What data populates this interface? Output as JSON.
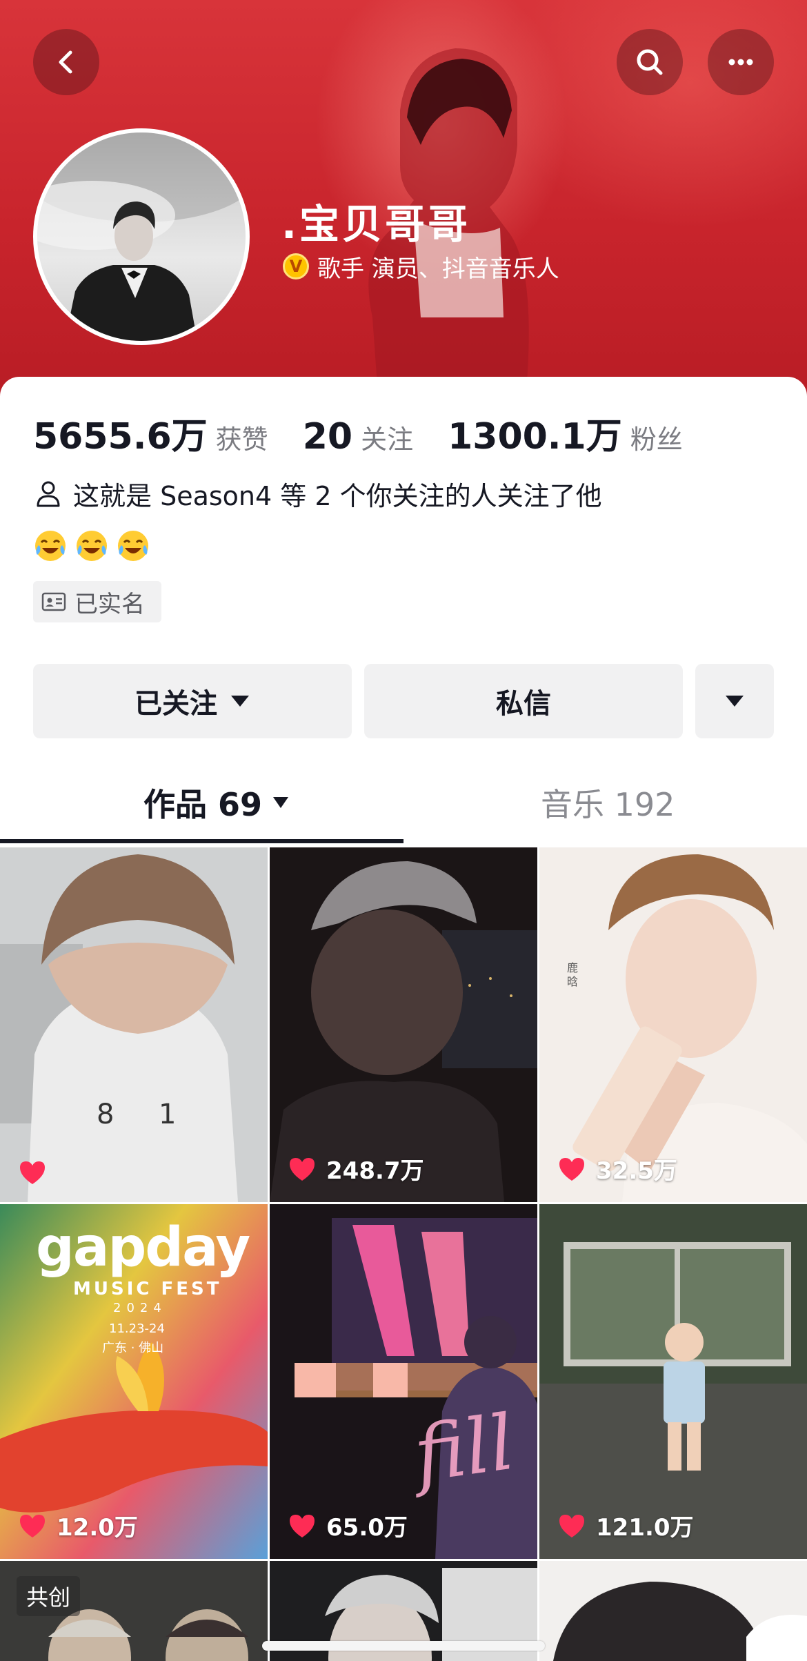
{
  "header": {
    "back_icon": "chevron-left-icon",
    "search_icon": "search-icon",
    "more_icon": "more-horizontal-icon",
    "banner_color": "#c8242c"
  },
  "profile": {
    "name": ".宝贝哥哥",
    "verified_badge": "V",
    "verified_text": "歌手 演员、抖音音乐人"
  },
  "stats": [
    {
      "value": "5655.6万",
      "label": "获赞"
    },
    {
      "value": "20",
      "label": "关注"
    },
    {
      "value": "1300.1万",
      "label": "粉丝"
    }
  ],
  "mutual": {
    "icon": "person-icon",
    "text": "这就是 Season4 等 2 个你关注的人关注了他"
  },
  "bio_emojis": [
    "😂",
    "😂",
    "😂"
  ],
  "realname_tag": {
    "icon": "id-card-icon",
    "text": "已实名"
  },
  "actions": {
    "follow_label": "已关注",
    "message_label": "私信"
  },
  "tabs": [
    {
      "label": "作品 69",
      "active": true
    },
    {
      "label": "音乐 192",
      "active": false
    }
  ],
  "videos": [
    {
      "likes": ""
    },
    {
      "likes": "248.7万"
    },
    {
      "likes": "32.5万"
    },
    {
      "likes": "12.0万",
      "poster_title": "gapday",
      "poster_sub": "MUSIC FEST",
      "poster_year": "2024",
      "poster_date": "11.23-24",
      "poster_place": "广东 · 佛山"
    },
    {
      "likes": "65.0万",
      "poster_text": "fill"
    },
    {
      "likes": "121.0万"
    },
    {
      "tag": "共创"
    },
    {},
    {}
  ],
  "accent_color": "#fe2c55"
}
